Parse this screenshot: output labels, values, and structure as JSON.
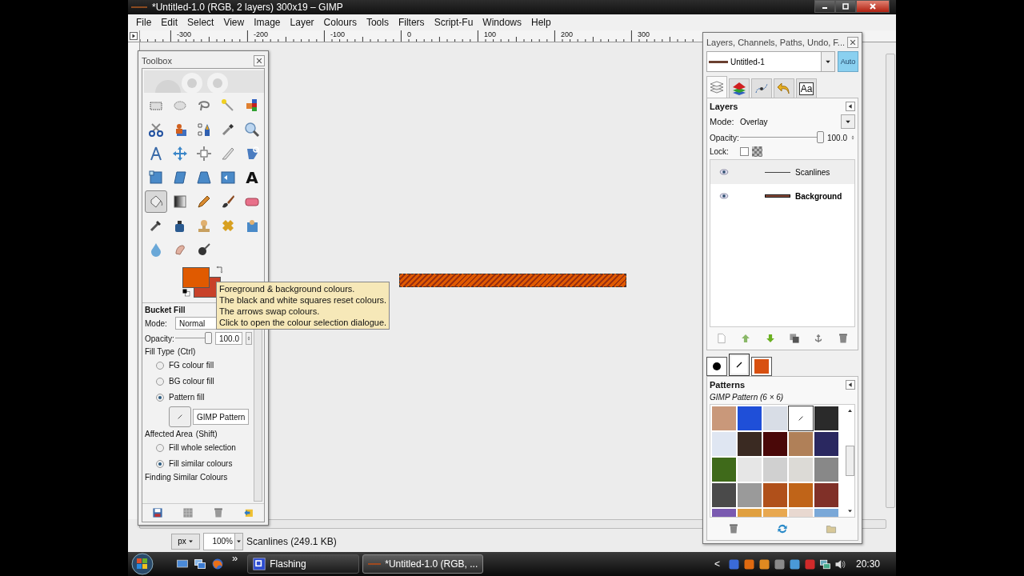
{
  "window": {
    "title": "*Untitled-1.0 (RGB, 2 layers) 300x19 – GIMP"
  },
  "menu": [
    "File",
    "Edit",
    "Select",
    "View",
    "Image",
    "Layer",
    "Colours",
    "Tools",
    "Filters",
    "Script-Fu",
    "Windows",
    "Help"
  ],
  "ruler": {
    "labels": [
      "-300",
      "-200",
      "-100",
      "0",
      "100",
      "200",
      "300"
    ]
  },
  "toolbox": {
    "title": "Toolbox",
    "tools": [
      {
        "kind": "rectangle",
        "selected": false
      },
      {
        "kind": "ellipse",
        "selected": false
      },
      {
        "kind": "lasso",
        "selected": false
      },
      {
        "kind": "wand",
        "selected": false
      },
      {
        "kind": "swatches",
        "selected": false
      },
      {
        "kind": "scissors",
        "selected": false
      },
      {
        "kind": "figure",
        "selected": false
      },
      {
        "kind": "pen",
        "selected": false
      },
      {
        "kind": "dropper",
        "selected": false
      },
      {
        "kind": "magnifier",
        "selected": false
      },
      {
        "kind": "compass",
        "selected": false
      },
      {
        "kind": "move",
        "selected": false
      },
      {
        "kind": "align",
        "selected": false
      },
      {
        "kind": "knife",
        "selected": false
      },
      {
        "kind": "rotate",
        "selected": false
      },
      {
        "kind": "scale",
        "selected": false
      },
      {
        "kind": "shear",
        "selected": false
      },
      {
        "kind": "perspective",
        "selected": false
      },
      {
        "kind": "flip",
        "selected": false
      },
      {
        "kind": "text",
        "glyph": "A",
        "selected": false
      },
      {
        "kind": "bucket",
        "selected": true
      },
      {
        "kind": "gradient",
        "selected": false
      },
      {
        "kind": "pencil",
        "selected": false
      },
      {
        "kind": "brush",
        "selected": false
      },
      {
        "kind": "eraser",
        "selected": false
      },
      {
        "kind": "airbrush",
        "selected": false
      },
      {
        "kind": "ink",
        "selected": false
      },
      {
        "kind": "stamp",
        "selected": false
      },
      {
        "kind": "heal",
        "selected": false
      },
      {
        "kind": "clone",
        "selected": false
      },
      {
        "kind": "drop",
        "selected": false
      },
      {
        "kind": "finger",
        "selected": false
      },
      {
        "kind": "dodge",
        "selected": false
      }
    ],
    "colors": [
      {
        "kind": "foreground",
        "color": "#e05a00"
      },
      {
        "kind": "background",
        "color": "#c8422a"
      }
    ],
    "options": {
      "title": "Bucket Fill",
      "mode_label": "Mode:",
      "mode": "Normal",
      "opacity_label": "Opacity:",
      "opacity": "100.0",
      "level": 1,
      "groups": [
        {
          "label": "Fill Type",
          "hint": "(Ctrl)",
          "choices": [
            {
              "label": "FG colour fill",
              "selected": false
            },
            {
              "label": "BG colour fill",
              "selected": false
            },
            {
              "label": "Pattern fill",
              "selected": true
            }
          ],
          "pattern": "GIMP Pattern"
        },
        {
          "label": "Affected Area",
          "hint": "(Shift)",
          "choices": [
            {
              "label": "Fill whole selection",
              "selected": false
            },
            {
              "label": "Fill similar colours",
              "selected": true
            }
          ]
        }
      ],
      "next_section": "Finding Similar Colours"
    }
  },
  "tooltip": {
    "lines": [
      "Foreground & background colours.",
      "The black and white squares reset colours.",
      "The arrows swap colours.",
      "Click to open the colour selection dialogue."
    ]
  },
  "dock": {
    "title": "Layers, Channels, Paths, Undo, F...",
    "image": "Untitled-1",
    "auto": {
      "label": "Auto",
      "on": true
    },
    "tabs": [
      {
        "kind": "layers",
        "selected": true
      },
      {
        "kind": "channels",
        "selected": false
      },
      {
        "kind": "paths",
        "selected": false
      },
      {
        "kind": "undo",
        "selected": false
      },
      {
        "kind": "fonts",
        "glyph": "Aa",
        "selected": false
      }
    ],
    "layers_panel": {
      "title": "Layers",
      "mode_label": "Mode:",
      "mode": "Overlay",
      "opacity_label": "Opacity:",
      "opacity": "100.0",
      "level": 1,
      "lock_label": "Lock:",
      "lock": false,
      "layers": [
        {
          "name": "Scanlines",
          "kind": "thin",
          "visible": true,
          "selected": true,
          "bold": false
        },
        {
          "name": "Background",
          "kind": "thick",
          "visible": true,
          "selected": false,
          "bold": true
        }
      ]
    },
    "lower_tabs": [
      {
        "kind": "brush",
        "selected": false
      },
      {
        "kind": "pattern",
        "selected": true
      },
      {
        "kind": "gradient",
        "selected": false
      }
    ],
    "patterns_panel": {
      "title": "Patterns",
      "subtitle": "GIMP Pattern (6 × 6)",
      "patterns": [
        {
          "color": "#c9987a",
          "selected": false
        },
        {
          "color": "#1f4fd8",
          "selected": false
        },
        {
          "color": "#d8dde6",
          "selected": false
        },
        {
          "color": "#ffffff",
          "selected": true
        },
        {
          "color": "#2a2a2a",
          "selected": false
        },
        {
          "color": "#dfe6f2",
          "selected": false
        },
        {
          "color": "#3a2a22",
          "selected": false
        },
        {
          "color": "#4a0808",
          "selected": false
        },
        {
          "color": "#b08058",
          "selected": false
        },
        {
          "color": "#2a2860",
          "selected": false
        },
        {
          "color": "#3f6a1a",
          "selected": false
        },
        {
          "color": "#e6e6e6",
          "selected": false
        },
        {
          "color": "#d0d0d0",
          "selected": false
        },
        {
          "color": "#dcdad6",
          "selected": false
        },
        {
          "color": "#888888",
          "selected": false
        },
        {
          "color": "#4a4a4a",
          "selected": false
        },
        {
          "color": "#9a9a9a",
          "selected": false
        },
        {
          "color": "#b0501a",
          "selected": false
        },
        {
          "color": "#c06418",
          "selected": false
        },
        {
          "color": "#803028",
          "selected": false
        },
        {
          "color": "#7a5ab0",
          "selected": false
        },
        {
          "color": "#e0a040",
          "selected": false
        },
        {
          "color": "#e8a850",
          "selected": false
        },
        {
          "color": "#e8d8d0",
          "selected": false
        },
        {
          "color": "#7aa8d8",
          "selected": false
        }
      ]
    }
  },
  "status": {
    "unit": "px",
    "zoom": "100%",
    "message": "Scanlines (249.1 KB)"
  },
  "taskbar": {
    "more": "»",
    "tasks": [
      {
        "label": "Flashing",
        "selected": false
      },
      {
        "label": "*Untitled-1.0 (RGB, ...",
        "selected": true
      }
    ],
    "tray_arrow": "<",
    "clock": "20:30"
  }
}
